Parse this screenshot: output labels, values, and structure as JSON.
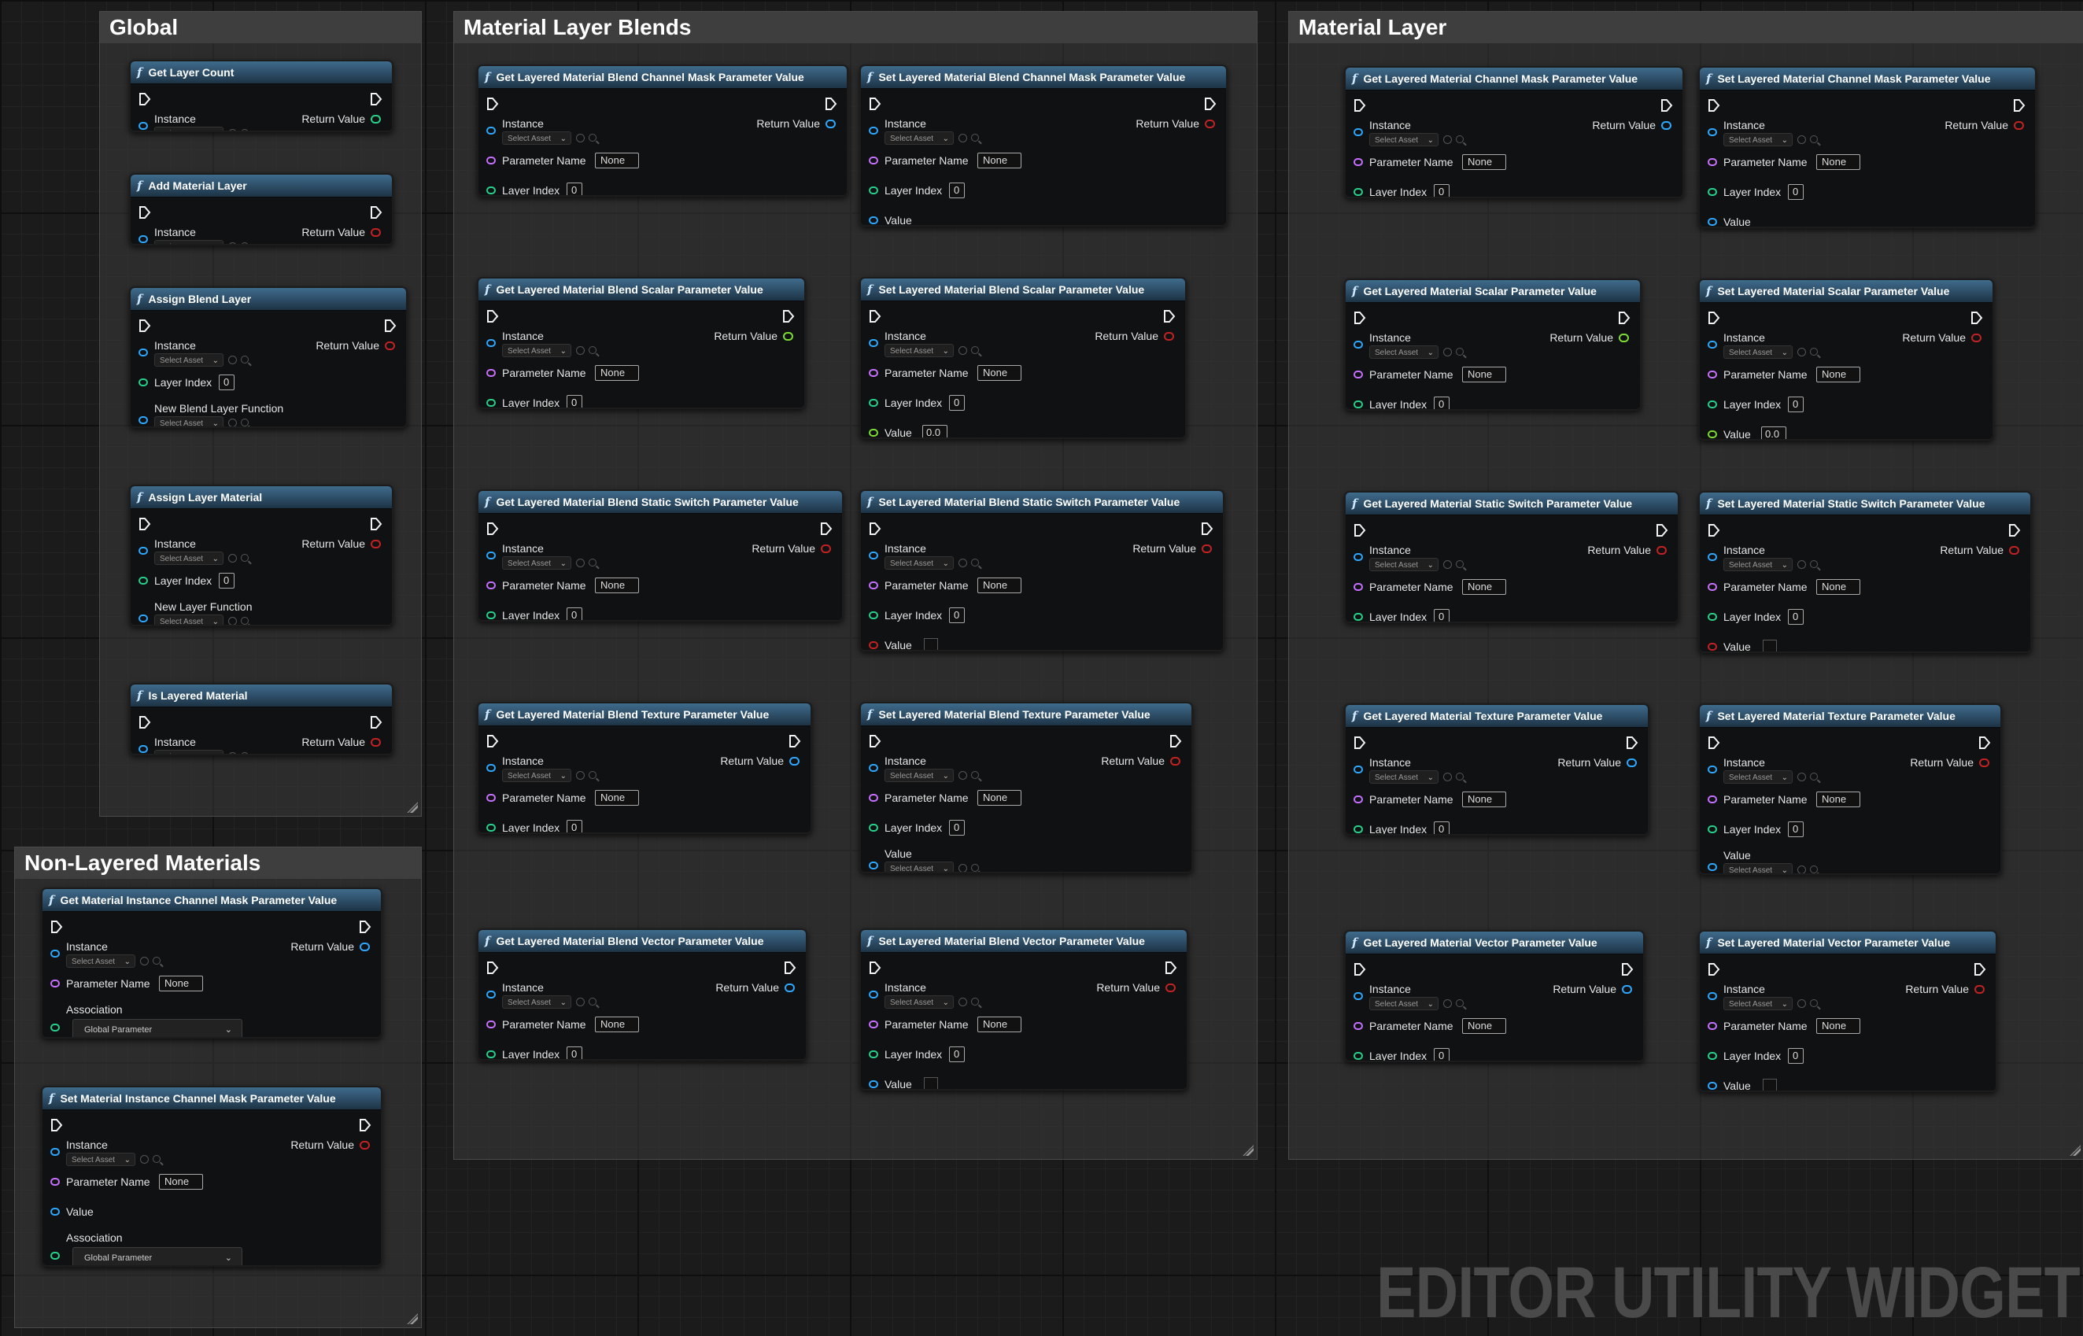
{
  "groups": {
    "global": "Global",
    "blends": "Material Layer Blends",
    "layer": "Material Layer",
    "nonlayered": "Non-Layered Materials"
  },
  "labels": {
    "instance": "Instance",
    "return_value": "Return Value",
    "select_asset": "Select Asset",
    "parameter_name": "Parameter Name",
    "layer_index": "Layer Index",
    "value": "Value",
    "none": "None",
    "zero": "0",
    "float_zero": "0.0",
    "new_blend_layer_function": "New Blend Layer Function",
    "new_layer_function": "New Layer Function",
    "association": "Association",
    "global_parameter": "Global Parameter",
    "func_glyph": "f"
  },
  "nodes": {
    "get_layer_count": "Get Layer Count",
    "add_material_layer": "Add Material Layer",
    "assign_blend_layer": "Assign Blend Layer",
    "assign_layer_material": "Assign Layer Material",
    "is_layered_material": "Is Layered Material",
    "get_blend_channel_mask": "Get Layered Material Blend Channel Mask Parameter Value",
    "set_blend_channel_mask": "Set Layered Material Blend Channel Mask Parameter Value",
    "get_blend_scalar": "Get Layered Material Blend Scalar Parameter Value",
    "set_blend_scalar": "Set Layered Material Blend Scalar Parameter Value",
    "get_blend_static_switch": "Get Layered Material Blend Static Switch Parameter Value",
    "set_blend_static_switch": "Set Layered Material Blend Static Switch Parameter Value",
    "get_blend_texture": "Get Layered Material Blend Texture Parameter Value",
    "set_blend_texture": "Set Layered Material Blend Texture Parameter Value",
    "get_blend_vector": "Get Layered Material Blend Vector Parameter Value",
    "set_blend_vector": "Set Layered Material Blend Vector Parameter Value",
    "get_layer_channel_mask": "Get Layered Material Channel Mask Parameter Value",
    "set_layer_channel_mask": "Set Layered Material Channel Mask Parameter Value",
    "get_layer_scalar": "Get Layered Material Scalar Parameter Value",
    "set_layer_scalar": "Set Layered Material Scalar Parameter Value",
    "get_layer_static_switch": "Get Layered Material Static Switch Parameter Value",
    "set_layer_static_switch": "Set Layered Material Static Switch Parameter Value",
    "get_layer_texture": "Get Layered Material Texture Parameter Value",
    "set_layer_texture": "Set Layered Material Texture Parameter Value",
    "get_layer_vector": "Get Layered Material Vector Parameter Value",
    "set_layer_vector": "Set Layered Material Vector Parameter Value",
    "get_instance_channel_mask": "Get Material Instance Channel Mask Parameter Value",
    "set_instance_channel_mask": "Set Material Instance Channel Mask Parameter Value"
  },
  "watermark": "EDITOR UTILITY WIDGET",
  "colors": {
    "object_pin": "#2ea7ff",
    "name_pin": "#c770ff",
    "int_pin": "#27d18a",
    "float_pin": "#7bdc34",
    "bool_pin": "#c22222",
    "node_header": "#2d5373"
  },
  "icons": [
    "function-icon",
    "exec-pin-icon",
    "browse-icon",
    "search-icon",
    "chevron-down-icon",
    "resize-grip-icon"
  ]
}
